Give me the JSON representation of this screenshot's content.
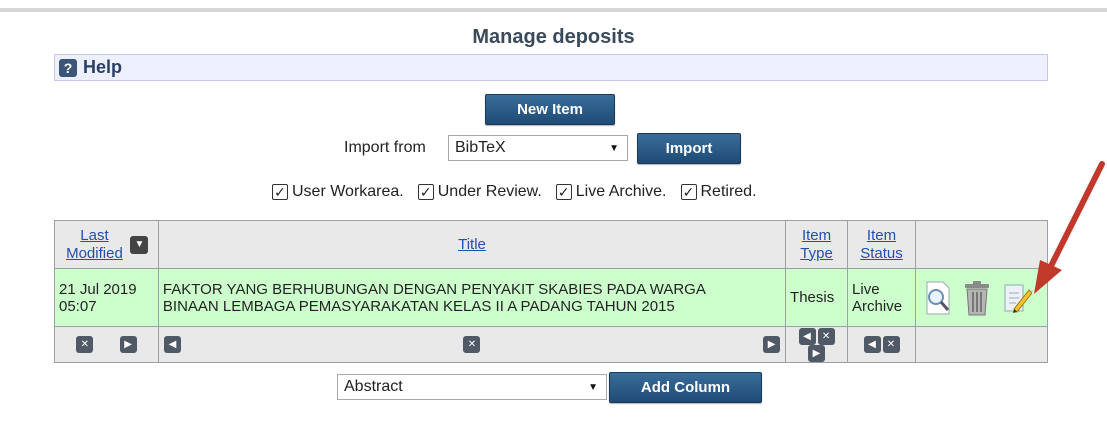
{
  "page": {
    "title": "Manage deposits"
  },
  "help": {
    "label": "Help"
  },
  "toolbar": {
    "new_item_label": "New Item",
    "import_from_label": "Import from",
    "import_format": "BibTeX",
    "import_label": "Import"
  },
  "filters": [
    {
      "label": "User Workarea.",
      "checked": true
    },
    {
      "label": "Under Review.",
      "checked": true
    },
    {
      "label": "Live Archive.",
      "checked": true
    },
    {
      "label": "Retired.",
      "checked": true
    }
  ],
  "table": {
    "headers": {
      "last_modified": "Last Modified",
      "title": "Title",
      "item_type": "Item Type",
      "item_status": "Item Status"
    },
    "rows": [
      {
        "date": "21 Jul 2019",
        "time": "05:07",
        "title_line1": "FAKTOR YANG BERHUBUNGAN DENGAN PENYAKIT SKABIES PADA WARGA",
        "title_line2": "BINAAN LEMBAGA PEMASYARAKATAN KELAS II A PADANG TAHUN 2015",
        "item_type": "Thesis",
        "status_line1": "Live",
        "status_line2": "Archive"
      }
    ]
  },
  "add_column": {
    "selected": "Abstract",
    "button_label": "Add Column"
  },
  "colors": {
    "row_bg": "#ccffcc",
    "button": "#1e4b76",
    "link": "#2150a8",
    "help_bg": "#eef0ff",
    "annotation_arrow": "#c0392b"
  },
  "icons": [
    "help-icon",
    "sort-desc-icon",
    "view-icon",
    "trash-icon",
    "edit-icon",
    "remove-column-icon",
    "move-left-icon",
    "move-right-icon"
  ]
}
